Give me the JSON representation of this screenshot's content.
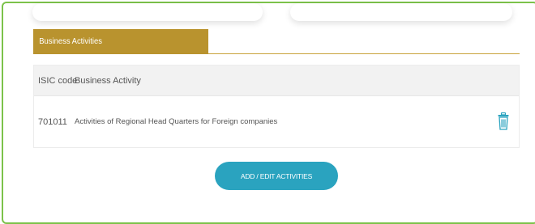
{
  "section": {
    "title": "Business Activities"
  },
  "table": {
    "headers": {
      "code": "ISIC code",
      "activity": "Business Activity"
    },
    "rows": [
      {
        "code": "701011",
        "activity": "Activities of Regional Head Quarters for Foreign companies"
      }
    ]
  },
  "actions": {
    "add_edit_label": "ADD / EDIT ACTIVITIES"
  },
  "icons": {
    "delete": "trash-icon"
  },
  "colors": {
    "accent_gold": "#b9932e",
    "button_teal": "#2aa3bf",
    "frame_green": "#7cc24a"
  }
}
